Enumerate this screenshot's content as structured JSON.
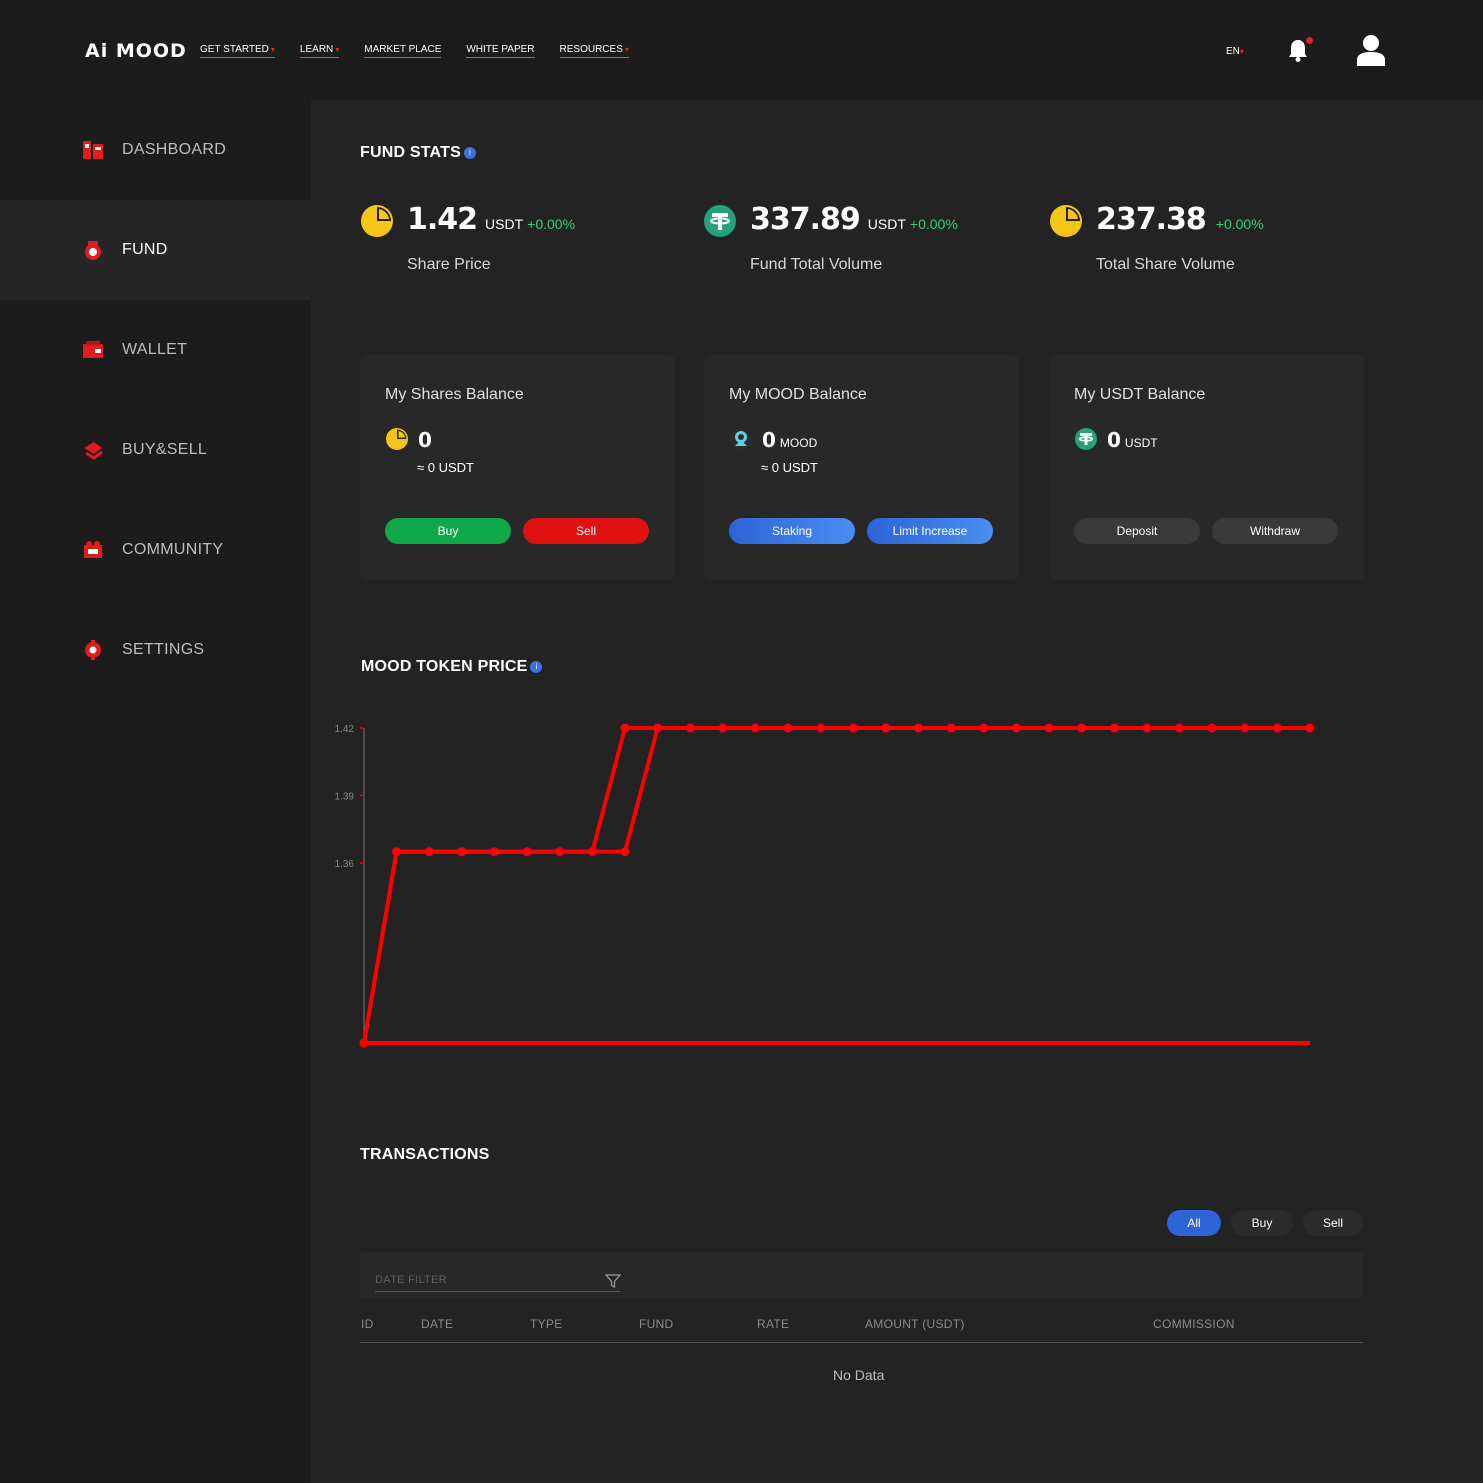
{
  "header": {
    "logo": "Ai MOOD",
    "nav": [
      {
        "label": "GET STARTED",
        "dropdown": true
      },
      {
        "label": "LEARN",
        "dropdown": true
      },
      {
        "label": "MARKET PLACE",
        "dropdown": false
      },
      {
        "label": "WHITE PAPER",
        "dropdown": false
      },
      {
        "label": "RESOURCES",
        "dropdown": true
      }
    ],
    "lang": "EN",
    "notification_dot": true
  },
  "sidebar": {
    "items": [
      {
        "label": "DASHBOARD",
        "icon": "dashboard-icon",
        "active": false
      },
      {
        "label": "FUND",
        "icon": "fund-icon",
        "active": true
      },
      {
        "label": "WALLET",
        "icon": "wallet-icon",
        "active": false
      },
      {
        "label": "BUY&SELL",
        "icon": "buy-sell-icon",
        "active": false
      },
      {
        "label": "COMMUNITY",
        "icon": "community-icon",
        "active": false
      },
      {
        "label": "SETTINGS",
        "icon": "settings-icon",
        "active": false
      }
    ]
  },
  "fund_stats": {
    "title": "FUND STATS",
    "share_price": {
      "value": "1.42",
      "unit": "USDT",
      "change": "+0.00%",
      "label": "Share Price",
      "icon": "pie-chart-icon"
    },
    "fund_total_volume": {
      "value": "337.89",
      "unit": "USDT",
      "change": "+0.00%",
      "label": "Fund Total Volume",
      "icon": "tether-icon"
    },
    "total_share_volume": {
      "value": "237.38",
      "unit": "",
      "change": "+0.00%",
      "label": "Total Share Volume",
      "icon": "pie-chart-icon"
    }
  },
  "cards": {
    "shares": {
      "title": "My Shares Balance",
      "value": "0",
      "unit": "",
      "approx": "≈ 0 USDT",
      "btn1": "Buy",
      "btn2": "Sell"
    },
    "mood": {
      "title": "My MOOD Balance",
      "value": "0",
      "unit": "MOOD",
      "approx": "≈ 0 USDT",
      "btn1": "Staking",
      "btn2": "Limit Increase"
    },
    "usdt": {
      "title": "My USDT Balance",
      "value": "0",
      "unit": "USDT",
      "approx": "",
      "btn1": "Deposit",
      "btn2": "Withdraw"
    }
  },
  "token_chart": {
    "title": "MOOD TOKEN PRICE",
    "line_color": "#ff0000"
  },
  "chart_data": {
    "type": "line",
    "title": "MOOD TOKEN PRICE",
    "xlabel": "",
    "ylabel": "",
    "y_ticks": [
      "1.42",
      "1.39",
      "1.36"
    ],
    "ylim": [
      1.28,
      1.42
    ],
    "grid": false,
    "series": [
      {
        "values": [
          1.28,
          1.365,
          1.365,
          1.365,
          1.365,
          1.365,
          1.365,
          1.365,
          1.42,
          1.42,
          1.42,
          1.42,
          1.42,
          1.42,
          1.42,
          1.42,
          1.42,
          1.42,
          1.42,
          1.42,
          1.42,
          1.42,
          1.42,
          1.42,
          1.42,
          1.42,
          1.42,
          1.42,
          1.42,
          1.42
        ]
      },
      {
        "values": [
          1.28,
          1.365,
          1.365,
          1.365,
          1.365,
          1.365,
          1.365,
          1.365,
          1.365,
          1.42,
          1.42,
          1.42,
          1.42,
          1.42,
          1.42,
          1.42,
          1.42,
          1.42,
          1.42,
          1.42,
          1.42,
          1.42,
          1.42,
          1.42,
          1.42,
          1.42,
          1.42,
          1.42,
          1.42,
          1.42
        ]
      }
    ]
  },
  "transactions": {
    "title": "TRANSACTIONS",
    "tabs": [
      "All",
      "Buy",
      "Sell"
    ],
    "active_tab": "All",
    "date_filter_placeholder": "DATE FILTER",
    "columns": [
      "ID",
      "DATE",
      "TYPE",
      "FUND",
      "RATE",
      "AMOUNT (USDT)",
      "COMMISSION"
    ],
    "empty": "No Data"
  }
}
